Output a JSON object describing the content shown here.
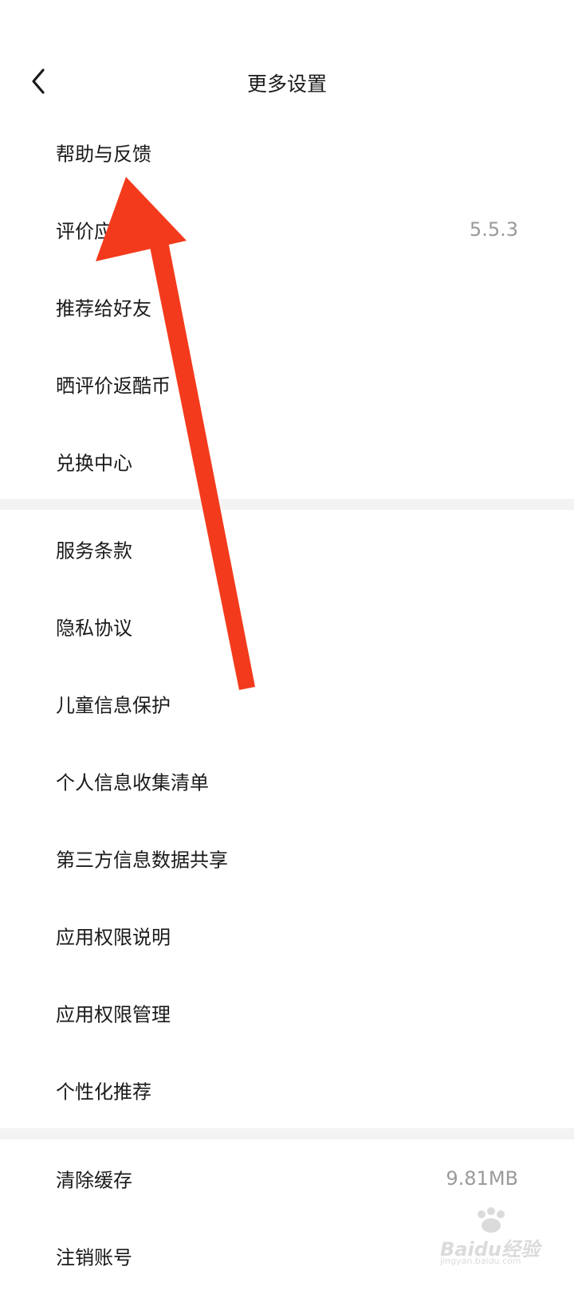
{
  "header": {
    "title": "更多设置",
    "back_icon": "chevron-left-icon"
  },
  "section1": {
    "items": [
      {
        "label": "帮助与反馈",
        "value": ""
      },
      {
        "label": "评价应用",
        "value": "5.5.3"
      },
      {
        "label": "推荐给好友",
        "value": ""
      },
      {
        "label": "晒评价返酷币",
        "value": ""
      },
      {
        "label": "兑换中心",
        "value": ""
      }
    ]
  },
  "section2": {
    "items": [
      {
        "label": "服务条款"
      },
      {
        "label": "隐私协议"
      },
      {
        "label": "儿童信息保护"
      },
      {
        "label": "个人信息收集清单"
      },
      {
        "label": "第三方信息数据共享"
      },
      {
        "label": "应用权限说明"
      },
      {
        "label": "应用权限管理"
      },
      {
        "label": "个性化推荐"
      }
    ]
  },
  "section3": {
    "items": [
      {
        "label": "清除缓存",
        "value": "9.81MB"
      },
      {
        "label": "注销账号",
        "value": ""
      }
    ]
  },
  "annotation": {
    "arrow_color": "#f43a1c"
  },
  "watermark": {
    "text": "Baidu经验",
    "sub": "jingyan.baidu.com"
  },
  "colors": {
    "background": "#ffffff",
    "divider": "#f3f3f3",
    "text": "#1a1a1a",
    "secondary_text": "#9a9a9a"
  }
}
